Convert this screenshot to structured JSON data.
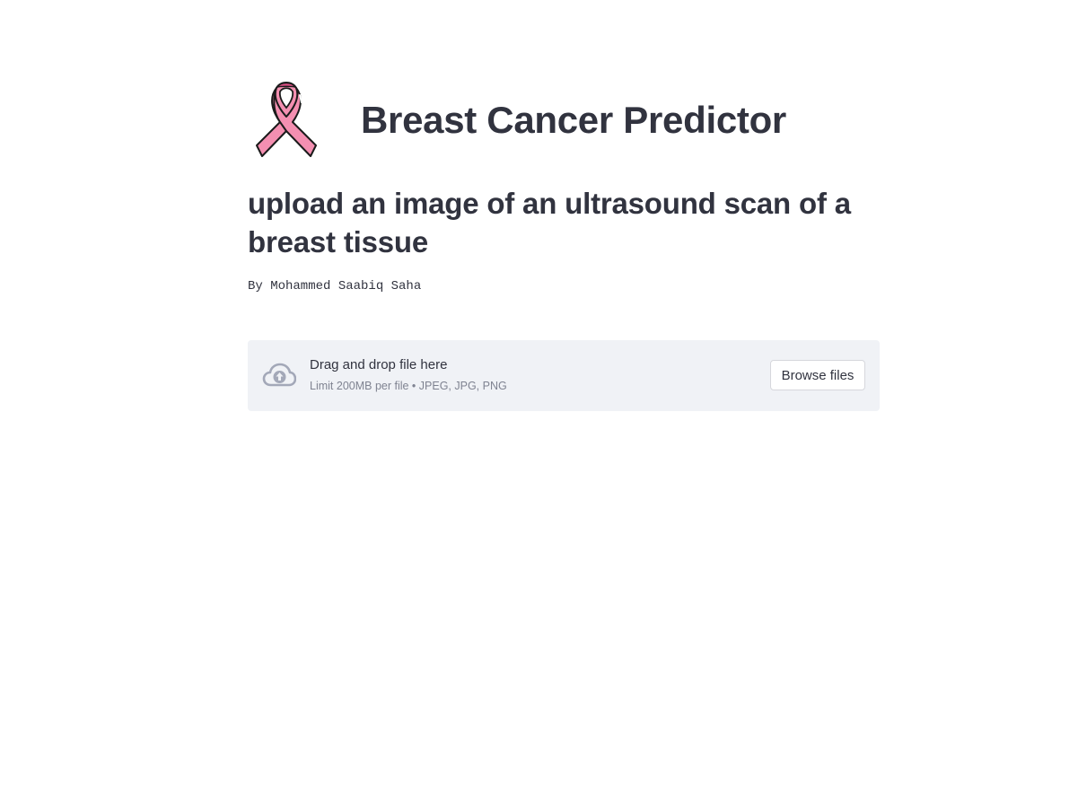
{
  "header": {
    "title": "Breast Cancer Predictor",
    "logo": "pink-ribbon-icon"
  },
  "subtitle": "upload an image of an ultrasound scan of a breast tissue",
  "byline": "By Mohammed Saabiq Saha",
  "uploader": {
    "icon": "cloud-upload-icon",
    "drop_label": "Drag and drop file here",
    "limit_label": "Limit 200MB per file • JPEG, JPG, PNG",
    "browse_label": "Browse files"
  },
  "colors": {
    "text": "#31333f",
    "ribbon_pink": "#f48fb1",
    "ribbon_dark": "#e04f86",
    "uploader_bg": "#f0f2f6",
    "muted_text": "#7f8391",
    "cloud_icon": "#a3a8b8"
  }
}
